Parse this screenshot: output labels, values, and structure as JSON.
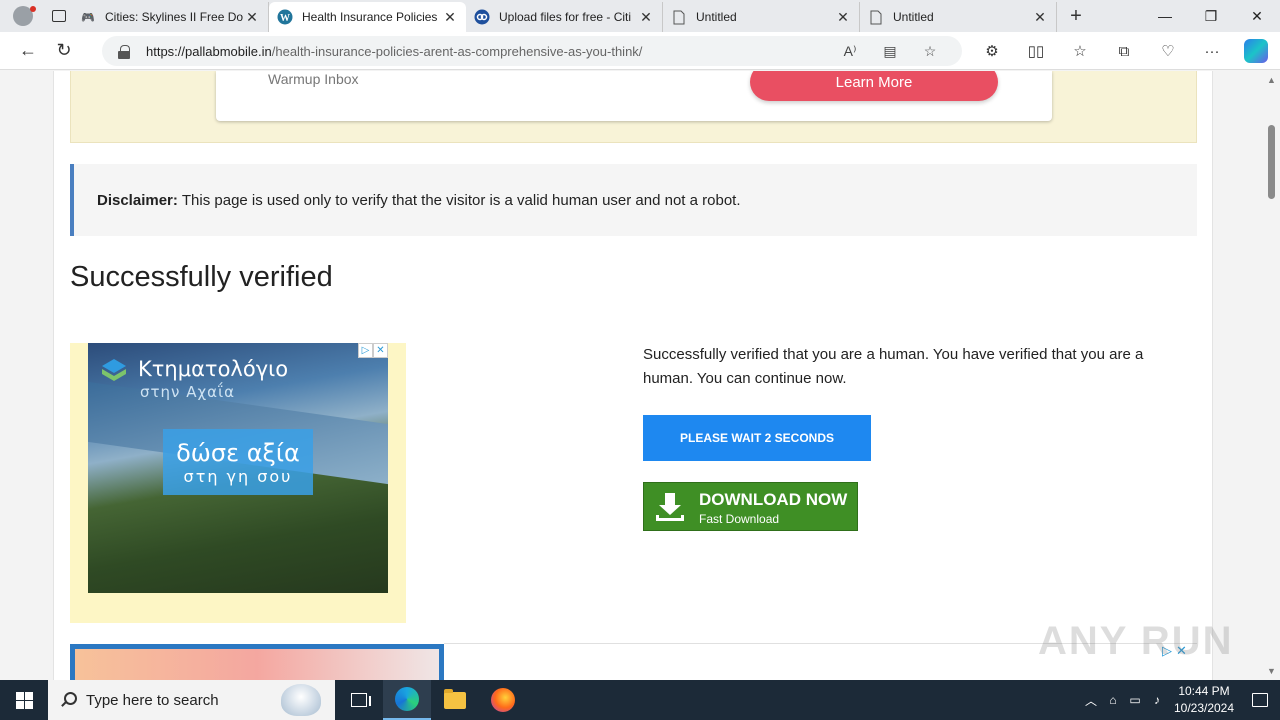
{
  "browser": {
    "tabs": [
      {
        "title": "Cities: Skylines II Free Do",
        "icon": "gamepad-icon",
        "active": false
      },
      {
        "title": "Health Insurance Policies",
        "icon": "wordpress-icon",
        "active": true
      },
      {
        "title": "Upload files for free - Citi",
        "icon": "upload-site-icon",
        "active": false
      },
      {
        "title": "Untitled",
        "icon": "page-icon",
        "active": false
      },
      {
        "title": "Untitled",
        "icon": "page-icon",
        "active": false
      }
    ],
    "url_domain": "https://pallabmobile.in",
    "url_path": "/health-insurance-policies-arent-as-comprehensive-as-you-think/"
  },
  "page": {
    "top_ad": {
      "label": "Warmup Inbox",
      "button": "Learn More"
    },
    "disclaimer": {
      "label": "Disclaimer:",
      "text": "This page is used only to verify that the visitor is a valid human user and not a robot."
    },
    "heading": "Successfully verified",
    "left_ad": {
      "title": "Κτηματολόγιο",
      "subtitle": "στην Αχαΐα",
      "box_line1": "δώσε αξία",
      "box_line2": "στη γη σου"
    },
    "verify_text": "Successfully verified that you are a human. You have verified that you are a human. You can continue now.",
    "wait_button": "PLEASE WAIT 2 SECONDS",
    "download": {
      "main": "DOWNLOAD NOW",
      "sub": "Fast Download"
    },
    "watermark": "ANY RUN"
  },
  "taskbar": {
    "search_placeholder": "Type here to search",
    "time": "10:44 PM",
    "date": "10/23/2024"
  },
  "colors": {
    "accent_blue": "#1e88f0",
    "download_green": "#3f8f25",
    "learn_more": "#e94f62",
    "ad_yellow": "#f8f3d7"
  }
}
